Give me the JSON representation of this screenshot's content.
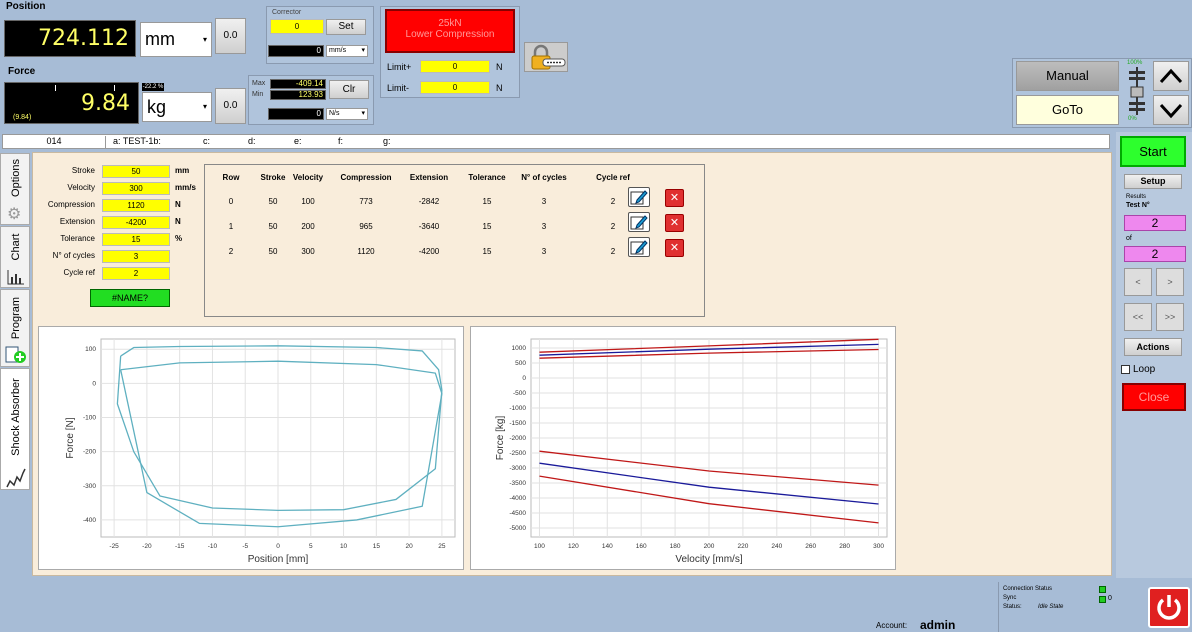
{
  "position": {
    "title": "Position",
    "value": "724.112",
    "unit": "mm",
    "zero_label": "0.0",
    "corrector_label": "Corrector",
    "corrector_value": "0",
    "set_label": "Set",
    "speed_value": "0",
    "speed_unit": "mm/s"
  },
  "force": {
    "title": "Force",
    "value": "9.84",
    "sub_value": "(9.84)",
    "percent": "-22.2 %",
    "unit": "kg",
    "zero_label": "0.0",
    "max_label": "Max",
    "min_label": "Min",
    "max_value": "-409.14",
    "min_value": "123.93",
    "clr_label": "Clr",
    "rate_value": "0",
    "rate_unit": "N/s"
  },
  "alarm": {
    "line1": "25kN",
    "line2": "Lower Compression",
    "limit_plus_label": "Limit+",
    "limit_plus_value": "0",
    "limit_minus_label": "Limit-",
    "limit_minus_value": "0",
    "unit": "N"
  },
  "controls": {
    "manual_label": "Manual",
    "goto_label": "GoTo",
    "pct_top": "100%",
    "pct_bottom": "0%"
  },
  "info_bar": {
    "id": "014",
    "fields": [
      "a: TEST-1b:",
      "c:",
      "d:",
      "e:",
      "f:",
      "g:"
    ]
  },
  "side_tabs": [
    "Options",
    "Chart",
    "Program",
    "Shock Absorber"
  ],
  "params": [
    {
      "label": "Stroke",
      "value": "50",
      "unit": "mm"
    },
    {
      "label": "Velocity",
      "value": "300",
      "unit": "mm/s"
    },
    {
      "label": "Compression",
      "value": "1120",
      "unit": "N"
    },
    {
      "label": "Extension",
      "value": "-4200",
      "unit": "N"
    },
    {
      "label": "Tolerance",
      "value": "15",
      "unit": "%"
    },
    {
      "label": "N° of cycles",
      "value": "3",
      "unit": ""
    },
    {
      "label": "Cycle ref",
      "value": "2",
      "unit": ""
    }
  ],
  "name_badge": "#NAME?",
  "table": {
    "headers": [
      "Row",
      "Stroke",
      "Velocity",
      "Compression",
      "Extension",
      "Tolerance",
      "N° of cycles",
      "Cycle ref"
    ],
    "rows": [
      [
        "0",
        "50",
        "100",
        "773",
        "-2842",
        "15",
        "3",
        "2"
      ],
      [
        "1",
        "50",
        "200",
        "965",
        "-3640",
        "15",
        "3",
        "2"
      ],
      [
        "2",
        "50",
        "300",
        "1120",
        "-4200",
        "15",
        "3",
        "2"
      ]
    ]
  },
  "right_panel": {
    "start_label": "Start",
    "setup_label": "Setup",
    "results_label": "Results",
    "test_label": "Test N°",
    "test_value": "2",
    "of_label": "of",
    "of_value": "2",
    "prev_label": "<",
    "next_label": ">",
    "first_label": "<<",
    "last_label": ">>",
    "actions_label": "Actions",
    "loop_label": "Loop",
    "close_label": "Close"
  },
  "status": {
    "connection_label": "Connection Status",
    "sync_label": "Sync",
    "sync_value": "0",
    "status_label": "Status:",
    "status_value": "Idle State",
    "account_label": "Account:",
    "account_value": "admin"
  },
  "colors": {
    "background": "#a7bcd6",
    "alarm_red": "#ff0000",
    "start_green": "#2dff2d",
    "yellow_field": "#ffff00",
    "pink_field": "#ee88ee",
    "curve_cyan": "#5fb0c0",
    "series_blue": "#1a1a9a",
    "series_red": "#c01818"
  },
  "chart_data": [
    {
      "type": "line",
      "title": "",
      "xlabel": "Position [mm]",
      "ylabel": "Force [N]",
      "xlim": [
        -27,
        27
      ],
      "ylim": [
        -450,
        130
      ],
      "xticks": [
        -25,
        -20,
        -15,
        -10,
        -5,
        0,
        5,
        10,
        15,
        20,
        25
      ],
      "yticks": [
        100,
        0,
        -100,
        -200,
        -300,
        -400
      ],
      "grid": true,
      "series": [
        {
          "x": [
            -24,
            -22,
            -15,
            0,
            15,
            22,
            24.5,
            25,
            24,
            18,
            10,
            0,
            -10,
            -18,
            -22,
            -24.5,
            -24
          ],
          "y": [
            80,
            105,
            108,
            110,
            105,
            95,
            40,
            -20,
            -250,
            -340,
            -370,
            -372,
            -365,
            -330,
            -200,
            -60,
            80
          ]
        },
        {
          "x": [
            -24,
            -15,
            0,
            15,
            24,
            25,
            22,
            12,
            0,
            -12,
            -20,
            -24
          ],
          "y": [
            40,
            60,
            65,
            55,
            30,
            -30,
            -360,
            -400,
            -420,
            -410,
            -320,
            40
          ]
        }
      ]
    },
    {
      "type": "line",
      "title": "",
      "xlabel": "Velocity [mm/s]",
      "ylabel": "Force [kg]",
      "xlim": [
        95,
        305
      ],
      "ylim": [
        -5300,
        1300
      ],
      "xticks": [
        100,
        120,
        140,
        160,
        180,
        200,
        220,
        240,
        260,
        280,
        300
      ],
      "yticks": [
        1000,
        0,
        -1000,
        -2000,
        -3000,
        -4000,
        -5000,
        500,
        -500,
        -1500,
        -2500,
        -3500,
        -4500
      ],
      "grid": true,
      "series": [
        {
          "color": "red",
          "x": [
            100,
            200,
            300
          ],
          "y": [
            860,
            1070,
            1290
          ]
        },
        {
          "color": "blue",
          "x": [
            100,
            200,
            300
          ],
          "y": [
            760,
            960,
            1120
          ]
        },
        {
          "color": "red",
          "x": [
            100,
            200,
            300
          ],
          "y": [
            660,
            830,
            950
          ]
        },
        {
          "color": "red",
          "x": [
            100,
            200,
            300
          ],
          "y": [
            -2440,
            -3100,
            -3570
          ]
        },
        {
          "color": "blue",
          "x": [
            100,
            200,
            300
          ],
          "y": [
            -2840,
            -3640,
            -4200
          ]
        },
        {
          "color": "red",
          "x": [
            100,
            200,
            300
          ],
          "y": [
            -3270,
            -4190,
            -4830
          ]
        }
      ]
    }
  ]
}
